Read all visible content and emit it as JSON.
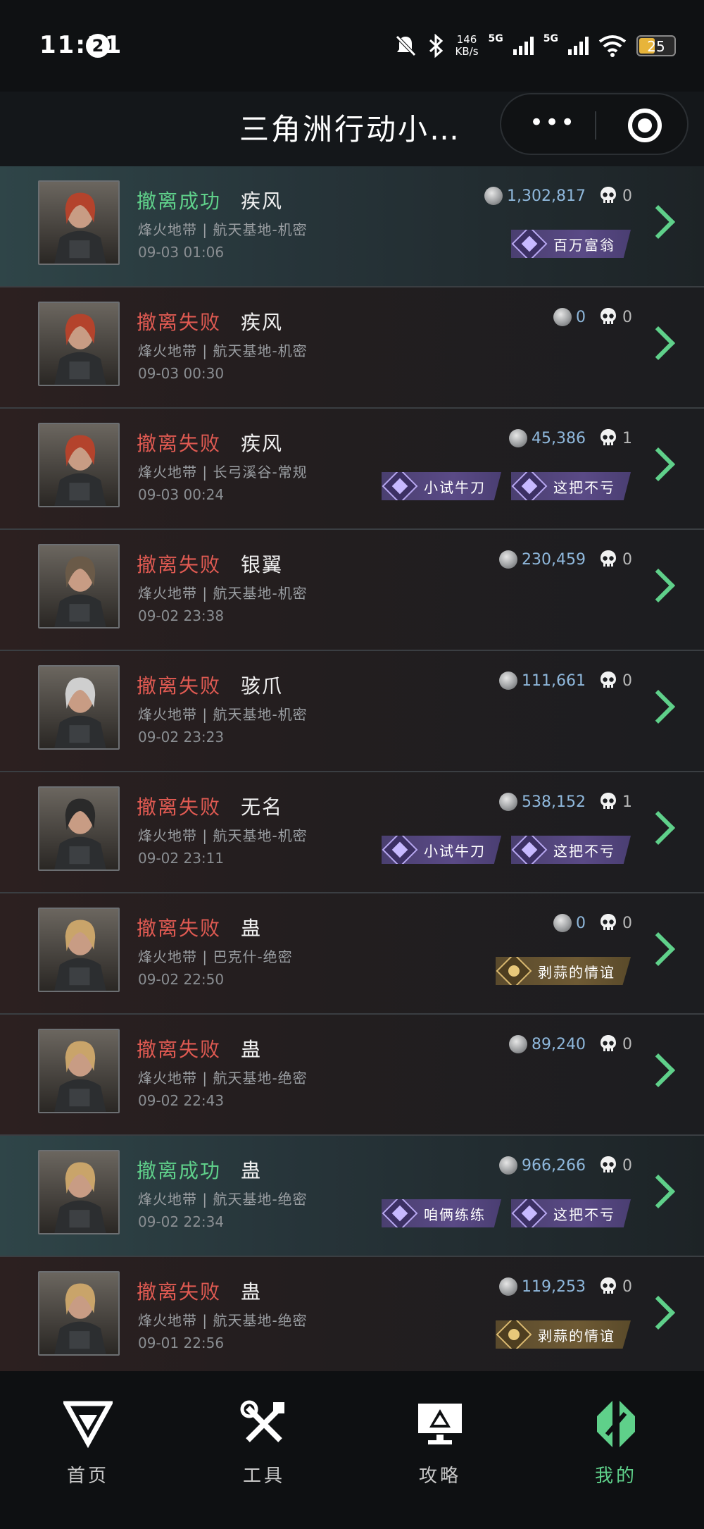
{
  "status_bar": {
    "time": "11:11",
    "notification_count": "2",
    "net_speed_value": "146",
    "net_speed_unit": "KB/s",
    "sim1": "5G",
    "sim2": "5G",
    "battery": "25"
  },
  "header": {
    "title": "三角洲行动小…"
  },
  "records": [
    {
      "status": "撤离成功",
      "success": true,
      "operator": "疾风",
      "map": "烽火地带 | 航天基地-机密",
      "time": "09-03 01:06",
      "value": "1,302,817",
      "kills": "0",
      "badges": [
        {
          "label": "百万富翁",
          "style": "purple"
        }
      ]
    },
    {
      "status": "撤离失败",
      "success": false,
      "operator": "疾风",
      "map": "烽火地带 | 航天基地-机密",
      "time": "09-03 00:30",
      "value": "0",
      "kills": "0",
      "badges": []
    },
    {
      "status": "撤离失败",
      "success": false,
      "operator": "疾风",
      "map": "烽火地带 | 长弓溪谷-常规",
      "time": "09-03 00:24",
      "value": "45,386",
      "kills": "1",
      "badges": [
        {
          "label": "小试牛刀",
          "style": "purple"
        },
        {
          "label": "这把不亏",
          "style": "purple"
        }
      ]
    },
    {
      "status": "撤离失败",
      "success": false,
      "operator": "银翼",
      "map": "烽火地带 | 航天基地-机密",
      "time": "09-02 23:38",
      "value": "230,459",
      "kills": "0",
      "badges": []
    },
    {
      "status": "撤离失败",
      "success": false,
      "operator": "骇爪",
      "map": "烽火地带 | 航天基地-机密",
      "time": "09-02 23:23",
      "value": "111,661",
      "kills": "0",
      "badges": []
    },
    {
      "status": "撤离失败",
      "success": false,
      "operator": "无名",
      "map": "烽火地带 | 航天基地-机密",
      "time": "09-02 23:11",
      "value": "538,152",
      "kills": "1",
      "badges": [
        {
          "label": "小试牛刀",
          "style": "purple"
        },
        {
          "label": "这把不亏",
          "style": "purple"
        }
      ]
    },
    {
      "status": "撤离失败",
      "success": false,
      "operator": "蛊",
      "map": "烽火地带 | 巴克什-绝密",
      "time": "09-02 22:50",
      "value": "0",
      "kills": "0",
      "badges": [
        {
          "label": "剥蒜的情谊",
          "style": "gold"
        }
      ]
    },
    {
      "status": "撤离失败",
      "success": false,
      "operator": "蛊",
      "map": "烽火地带 | 航天基地-绝密",
      "time": "09-02 22:43",
      "value": "89,240",
      "kills": "0",
      "badges": []
    },
    {
      "status": "撤离成功",
      "success": true,
      "operator": "蛊",
      "map": "烽火地带 | 航天基地-绝密",
      "time": "09-02 22:34",
      "value": "966,266",
      "kills": "0",
      "badges": [
        {
          "label": "咱俩练练",
          "style": "purple"
        },
        {
          "label": "这把不亏",
          "style": "purple"
        }
      ]
    },
    {
      "status": "撤离失败",
      "success": false,
      "operator": "蛊",
      "map": "烽火地带 | 航天基地-绝密",
      "time": "09-01 22:56",
      "value": "119,253",
      "kills": "0",
      "badges": [
        {
          "label": "剥蒜的情谊",
          "style": "gold"
        }
      ]
    }
  ],
  "nav": [
    {
      "label": "首页",
      "icon": "home-logo-icon",
      "active": false
    },
    {
      "label": "工具",
      "icon": "tools-icon",
      "active": false
    },
    {
      "label": "攻略",
      "icon": "guide-monitor-icon",
      "active": false
    },
    {
      "label": "我的",
      "icon": "profile-logo-icon",
      "active": true
    }
  ],
  "colors": {
    "success": "#5fd08a",
    "fail": "#e05a52",
    "value": "#8fb8dc",
    "accent": "#5fd08a"
  }
}
